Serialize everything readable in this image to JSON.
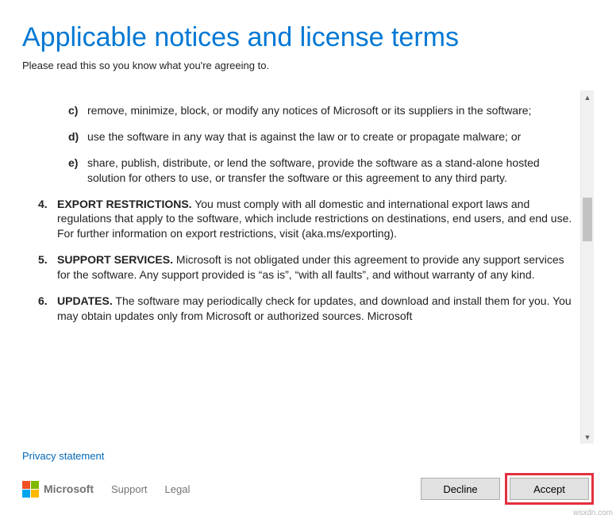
{
  "header": {
    "title": "Applicable notices and license terms",
    "subtitle": "Please read this so you know what you're agreeing to."
  },
  "terms": {
    "subitems": [
      {
        "marker": "c)",
        "text": "remove, minimize, block, or modify any notices of Microsoft or its suppliers in the software;"
      },
      {
        "marker": "d)",
        "text": "use the software in any way that is against the law or to create or propagate malware; or"
      },
      {
        "marker": "e)",
        "text": "share, publish, distribute, or lend the software, provide the software as a stand-alone hosted solution for others to use, or transfer the software or this agreement to any third party."
      }
    ],
    "mainitems": [
      {
        "marker": "4.",
        "head": "EXPORT RESTRICTIONS.",
        "text": " You must comply with all domestic and international export laws and regulations that apply to the software, which include restrictions on destinations, end users, and end use. For further information on export restrictions, visit (aka.ms/exporting)."
      },
      {
        "marker": "5.",
        "head": "SUPPORT SERVICES.",
        "text": " Microsoft is not obligated under this agreement to provide any support services for the software. Any support provided is “as is”, “with all faults”, and without warranty of any kind."
      },
      {
        "marker": "6.",
        "head": "UPDATES.",
        "text": " The software may periodically check for updates, and download and install them for you. You may obtain updates only from Microsoft or authorized sources. Microsoft"
      }
    ]
  },
  "links": {
    "privacy": "Privacy statement",
    "support": "Support",
    "legal": "Legal"
  },
  "brand": {
    "name": "Microsoft"
  },
  "buttons": {
    "decline": "Decline",
    "accept": "Accept"
  },
  "watermark": "wsxdn.com"
}
